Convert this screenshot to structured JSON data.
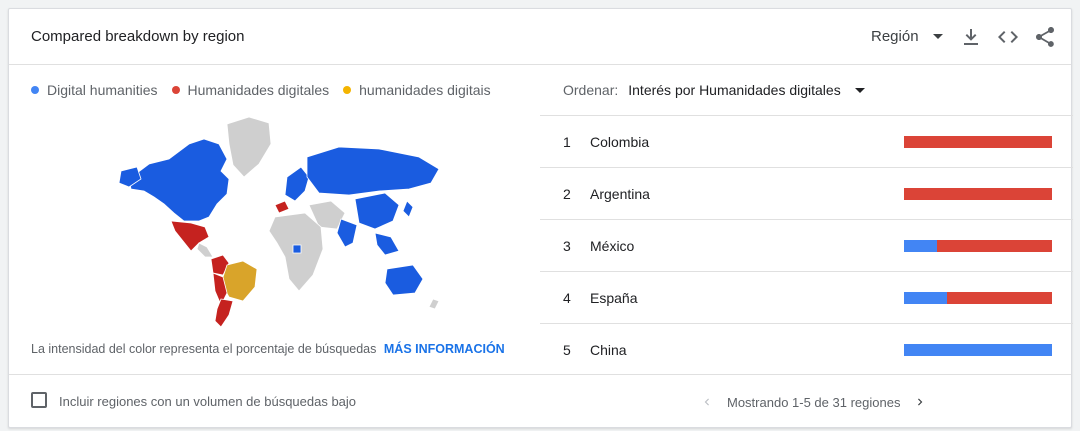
{
  "header": {
    "title": "Compared breakdown by region",
    "region_label": "Región"
  },
  "legend": [
    {
      "label": "Digital humanities",
      "color": "#4285f4"
    },
    {
      "label": "Humanidades digitales",
      "color": "#db4437"
    },
    {
      "label": "humanidades digitais",
      "color": "#f4b400"
    }
  ],
  "map": {
    "colors": {
      "blue": "#1a5ce0",
      "red": "#c5221f",
      "yellow": "#d9a42a",
      "gray": "#cfcfcf"
    }
  },
  "caption": {
    "text": "La intensidad del color representa el porcentaje de búsquedas",
    "link": "MÁS INFORMACIÓN"
  },
  "sort": {
    "label": "Ordenar:",
    "value": "Interés por Humanidades digitales"
  },
  "ranks": [
    {
      "num": "1",
      "name": "Colombia",
      "shares": {
        "Digital humanities": 0,
        "Humanidades digitales": 100,
        "humanidades digitais": 0
      }
    },
    {
      "num": "2",
      "name": "Argentina",
      "shares": {
        "Digital humanities": 0,
        "Humanidades digitales": 100,
        "humanidades digitais": 0
      }
    },
    {
      "num": "3",
      "name": "México",
      "shares": {
        "Digital humanities": 22,
        "Humanidades digitales": 78,
        "humanidades digitais": 0
      }
    },
    {
      "num": "4",
      "name": "España",
      "shares": {
        "Digital humanities": 29,
        "Humanidades digitales": 71,
        "humanidades digitais": 0
      }
    },
    {
      "num": "5",
      "name": "China",
      "shares": {
        "Digital humanities": 100,
        "Humanidades digitales": 0,
        "humanidades digitais": 0
      }
    }
  ],
  "footer": {
    "checkbox_label": "Incluir regiones con un volumen de búsquedas bajo",
    "pager_text": "Mostrando 1-5 de 31 regiones"
  }
}
